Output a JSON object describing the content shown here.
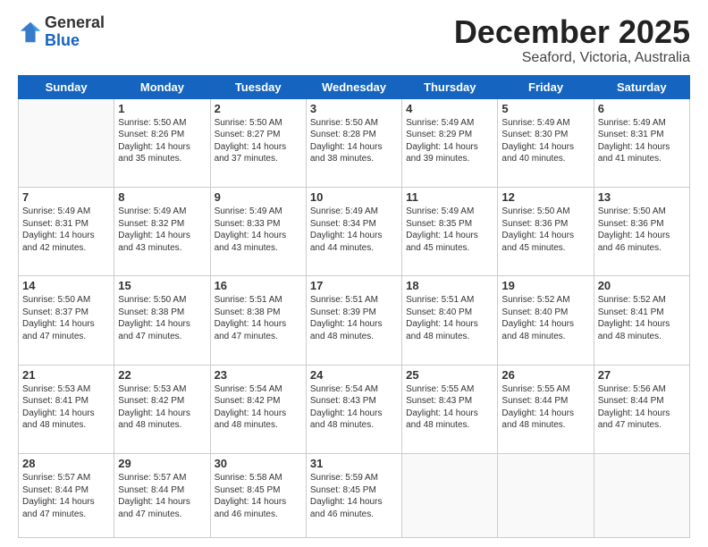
{
  "logo": {
    "general": "General",
    "blue": "Blue"
  },
  "header": {
    "month": "December 2025",
    "location": "Seaford, Victoria, Australia"
  },
  "weekdays": [
    "Sunday",
    "Monday",
    "Tuesday",
    "Wednesday",
    "Thursday",
    "Friday",
    "Saturday"
  ],
  "weeks": [
    [
      {
        "day": "",
        "empty": true
      },
      {
        "day": "1",
        "sunrise": "Sunrise: 5:50 AM",
        "sunset": "Sunset: 8:26 PM",
        "daylight": "Daylight: 14 hours and 35 minutes."
      },
      {
        "day": "2",
        "sunrise": "Sunrise: 5:50 AM",
        "sunset": "Sunset: 8:27 PM",
        "daylight": "Daylight: 14 hours and 37 minutes."
      },
      {
        "day": "3",
        "sunrise": "Sunrise: 5:50 AM",
        "sunset": "Sunset: 8:28 PM",
        "daylight": "Daylight: 14 hours and 38 minutes."
      },
      {
        "day": "4",
        "sunrise": "Sunrise: 5:49 AM",
        "sunset": "Sunset: 8:29 PM",
        "daylight": "Daylight: 14 hours and 39 minutes."
      },
      {
        "day": "5",
        "sunrise": "Sunrise: 5:49 AM",
        "sunset": "Sunset: 8:30 PM",
        "daylight": "Daylight: 14 hours and 40 minutes."
      },
      {
        "day": "6",
        "sunrise": "Sunrise: 5:49 AM",
        "sunset": "Sunset: 8:31 PM",
        "daylight": "Daylight: 14 hours and 41 minutes."
      }
    ],
    [
      {
        "day": "7",
        "sunrise": "Sunrise: 5:49 AM",
        "sunset": "Sunset: 8:31 PM",
        "daylight": "Daylight: 14 hours and 42 minutes."
      },
      {
        "day": "8",
        "sunrise": "Sunrise: 5:49 AM",
        "sunset": "Sunset: 8:32 PM",
        "daylight": "Daylight: 14 hours and 43 minutes."
      },
      {
        "day": "9",
        "sunrise": "Sunrise: 5:49 AM",
        "sunset": "Sunset: 8:33 PM",
        "daylight": "Daylight: 14 hours and 43 minutes."
      },
      {
        "day": "10",
        "sunrise": "Sunrise: 5:49 AM",
        "sunset": "Sunset: 8:34 PM",
        "daylight": "Daylight: 14 hours and 44 minutes."
      },
      {
        "day": "11",
        "sunrise": "Sunrise: 5:49 AM",
        "sunset": "Sunset: 8:35 PM",
        "daylight": "Daylight: 14 hours and 45 minutes."
      },
      {
        "day": "12",
        "sunrise": "Sunrise: 5:50 AM",
        "sunset": "Sunset: 8:36 PM",
        "daylight": "Daylight: 14 hours and 45 minutes."
      },
      {
        "day": "13",
        "sunrise": "Sunrise: 5:50 AM",
        "sunset": "Sunset: 8:36 PM",
        "daylight": "Daylight: 14 hours and 46 minutes."
      }
    ],
    [
      {
        "day": "14",
        "sunrise": "Sunrise: 5:50 AM",
        "sunset": "Sunset: 8:37 PM",
        "daylight": "Daylight: 14 hours and 47 minutes."
      },
      {
        "day": "15",
        "sunrise": "Sunrise: 5:50 AM",
        "sunset": "Sunset: 8:38 PM",
        "daylight": "Daylight: 14 hours and 47 minutes."
      },
      {
        "day": "16",
        "sunrise": "Sunrise: 5:51 AM",
        "sunset": "Sunset: 8:38 PM",
        "daylight": "Daylight: 14 hours and 47 minutes."
      },
      {
        "day": "17",
        "sunrise": "Sunrise: 5:51 AM",
        "sunset": "Sunset: 8:39 PM",
        "daylight": "Daylight: 14 hours and 48 minutes."
      },
      {
        "day": "18",
        "sunrise": "Sunrise: 5:51 AM",
        "sunset": "Sunset: 8:40 PM",
        "daylight": "Daylight: 14 hours and 48 minutes."
      },
      {
        "day": "19",
        "sunrise": "Sunrise: 5:52 AM",
        "sunset": "Sunset: 8:40 PM",
        "daylight": "Daylight: 14 hours and 48 minutes."
      },
      {
        "day": "20",
        "sunrise": "Sunrise: 5:52 AM",
        "sunset": "Sunset: 8:41 PM",
        "daylight": "Daylight: 14 hours and 48 minutes."
      }
    ],
    [
      {
        "day": "21",
        "sunrise": "Sunrise: 5:53 AM",
        "sunset": "Sunset: 8:41 PM",
        "daylight": "Daylight: 14 hours and 48 minutes."
      },
      {
        "day": "22",
        "sunrise": "Sunrise: 5:53 AM",
        "sunset": "Sunset: 8:42 PM",
        "daylight": "Daylight: 14 hours and 48 minutes."
      },
      {
        "day": "23",
        "sunrise": "Sunrise: 5:54 AM",
        "sunset": "Sunset: 8:42 PM",
        "daylight": "Daylight: 14 hours and 48 minutes."
      },
      {
        "day": "24",
        "sunrise": "Sunrise: 5:54 AM",
        "sunset": "Sunset: 8:43 PM",
        "daylight": "Daylight: 14 hours and 48 minutes."
      },
      {
        "day": "25",
        "sunrise": "Sunrise: 5:55 AM",
        "sunset": "Sunset: 8:43 PM",
        "daylight": "Daylight: 14 hours and 48 minutes."
      },
      {
        "day": "26",
        "sunrise": "Sunrise: 5:55 AM",
        "sunset": "Sunset: 8:44 PM",
        "daylight": "Daylight: 14 hours and 48 minutes."
      },
      {
        "day": "27",
        "sunrise": "Sunrise: 5:56 AM",
        "sunset": "Sunset: 8:44 PM",
        "daylight": "Daylight: 14 hours and 47 minutes."
      }
    ],
    [
      {
        "day": "28",
        "sunrise": "Sunrise: 5:57 AM",
        "sunset": "Sunset: 8:44 PM",
        "daylight": "Daylight: 14 hours and 47 minutes."
      },
      {
        "day": "29",
        "sunrise": "Sunrise: 5:57 AM",
        "sunset": "Sunset: 8:44 PM",
        "daylight": "Daylight: 14 hours and 47 minutes."
      },
      {
        "day": "30",
        "sunrise": "Sunrise: 5:58 AM",
        "sunset": "Sunset: 8:45 PM",
        "daylight": "Daylight: 14 hours and 46 minutes."
      },
      {
        "day": "31",
        "sunrise": "Sunrise: 5:59 AM",
        "sunset": "Sunset: 8:45 PM",
        "daylight": "Daylight: 14 hours and 46 minutes."
      },
      {
        "day": "",
        "empty": true
      },
      {
        "day": "",
        "empty": true
      },
      {
        "day": "",
        "empty": true
      }
    ]
  ]
}
